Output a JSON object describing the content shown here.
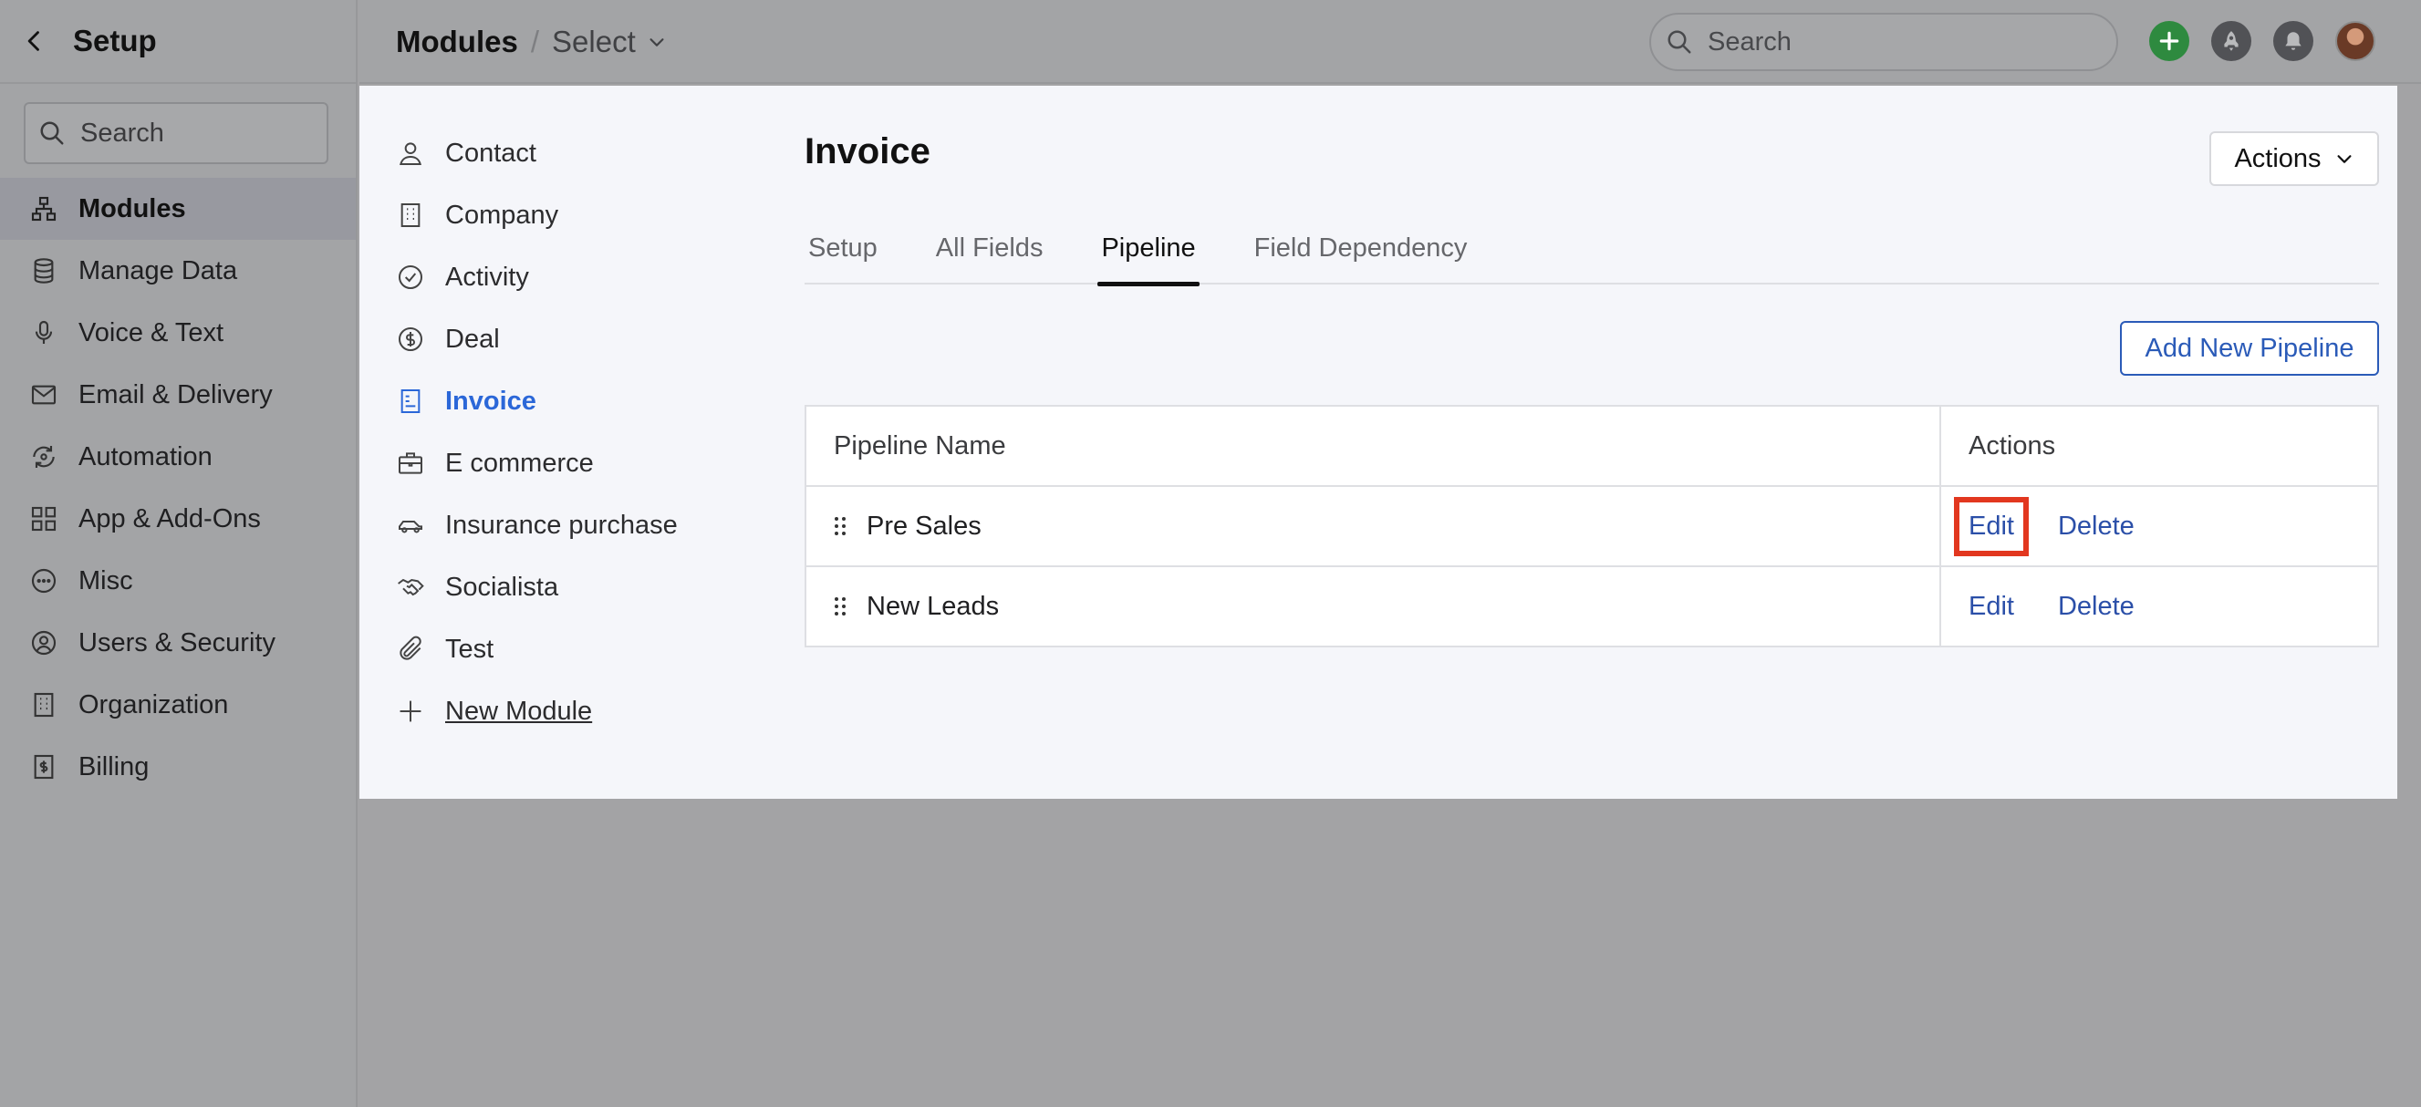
{
  "sidebar": {
    "title": "Setup",
    "search_placeholder": "Search",
    "items": [
      {
        "label": "Modules",
        "icon": "hierarchy-icon",
        "active": true
      },
      {
        "label": "Manage Data",
        "icon": "database-icon"
      },
      {
        "label": "Voice & Text",
        "icon": "microphone-icon"
      },
      {
        "label": "Email & Delivery",
        "icon": "envelope-icon"
      },
      {
        "label": "Automation",
        "icon": "automation-icon"
      },
      {
        "label": "App & Add-Ons",
        "icon": "apps-grid-icon"
      },
      {
        "label": "Misc",
        "icon": "more-circle-icon"
      },
      {
        "label": "Users & Security",
        "icon": "user-circle-icon"
      },
      {
        "label": "Organization",
        "icon": "building-icon"
      },
      {
        "label": "Billing",
        "icon": "receipt-icon"
      }
    ]
  },
  "topbar": {
    "breadcrumb_module": "Modules",
    "breadcrumb_separator": "/",
    "breadcrumb_select": "Select",
    "search_placeholder": "Search"
  },
  "modules": {
    "items": [
      {
        "label": "Contact",
        "icon": "person-icon"
      },
      {
        "label": "Company",
        "icon": "building-icon"
      },
      {
        "label": "Activity",
        "icon": "check-circle-icon"
      },
      {
        "label": "Deal",
        "icon": "dollar-circle-icon"
      },
      {
        "label": "Invoice",
        "icon": "invoice-icon",
        "active": true
      },
      {
        "label": "E commerce",
        "icon": "briefcase-icon"
      },
      {
        "label": "Insurance purchase",
        "icon": "car-icon"
      },
      {
        "label": "Socialista",
        "icon": "handshake-icon"
      },
      {
        "label": "Test",
        "icon": "paperclip-icon"
      }
    ],
    "new_module_label": "New Module"
  },
  "main": {
    "title": "Invoice",
    "actions_label": "Actions",
    "tabs": [
      {
        "label": "Setup"
      },
      {
        "label": "All Fields"
      },
      {
        "label": "Pipeline",
        "active": true
      },
      {
        "label": "Field Dependency"
      }
    ],
    "add_button_label": "Add New Pipeline",
    "table": {
      "headers": {
        "name": "Pipeline Name",
        "actions": "Actions"
      },
      "rows": [
        {
          "name": "Pre Sales",
          "edit": "Edit",
          "delete": "Delete"
        },
        {
          "name": "New Leads",
          "edit": "Edit",
          "delete": "Delete"
        }
      ]
    }
  },
  "colors": {
    "accent": "#2b67d8",
    "link": "#2b4fa8",
    "highlight": "#e2371f",
    "add_button": "#2e8a3f"
  }
}
